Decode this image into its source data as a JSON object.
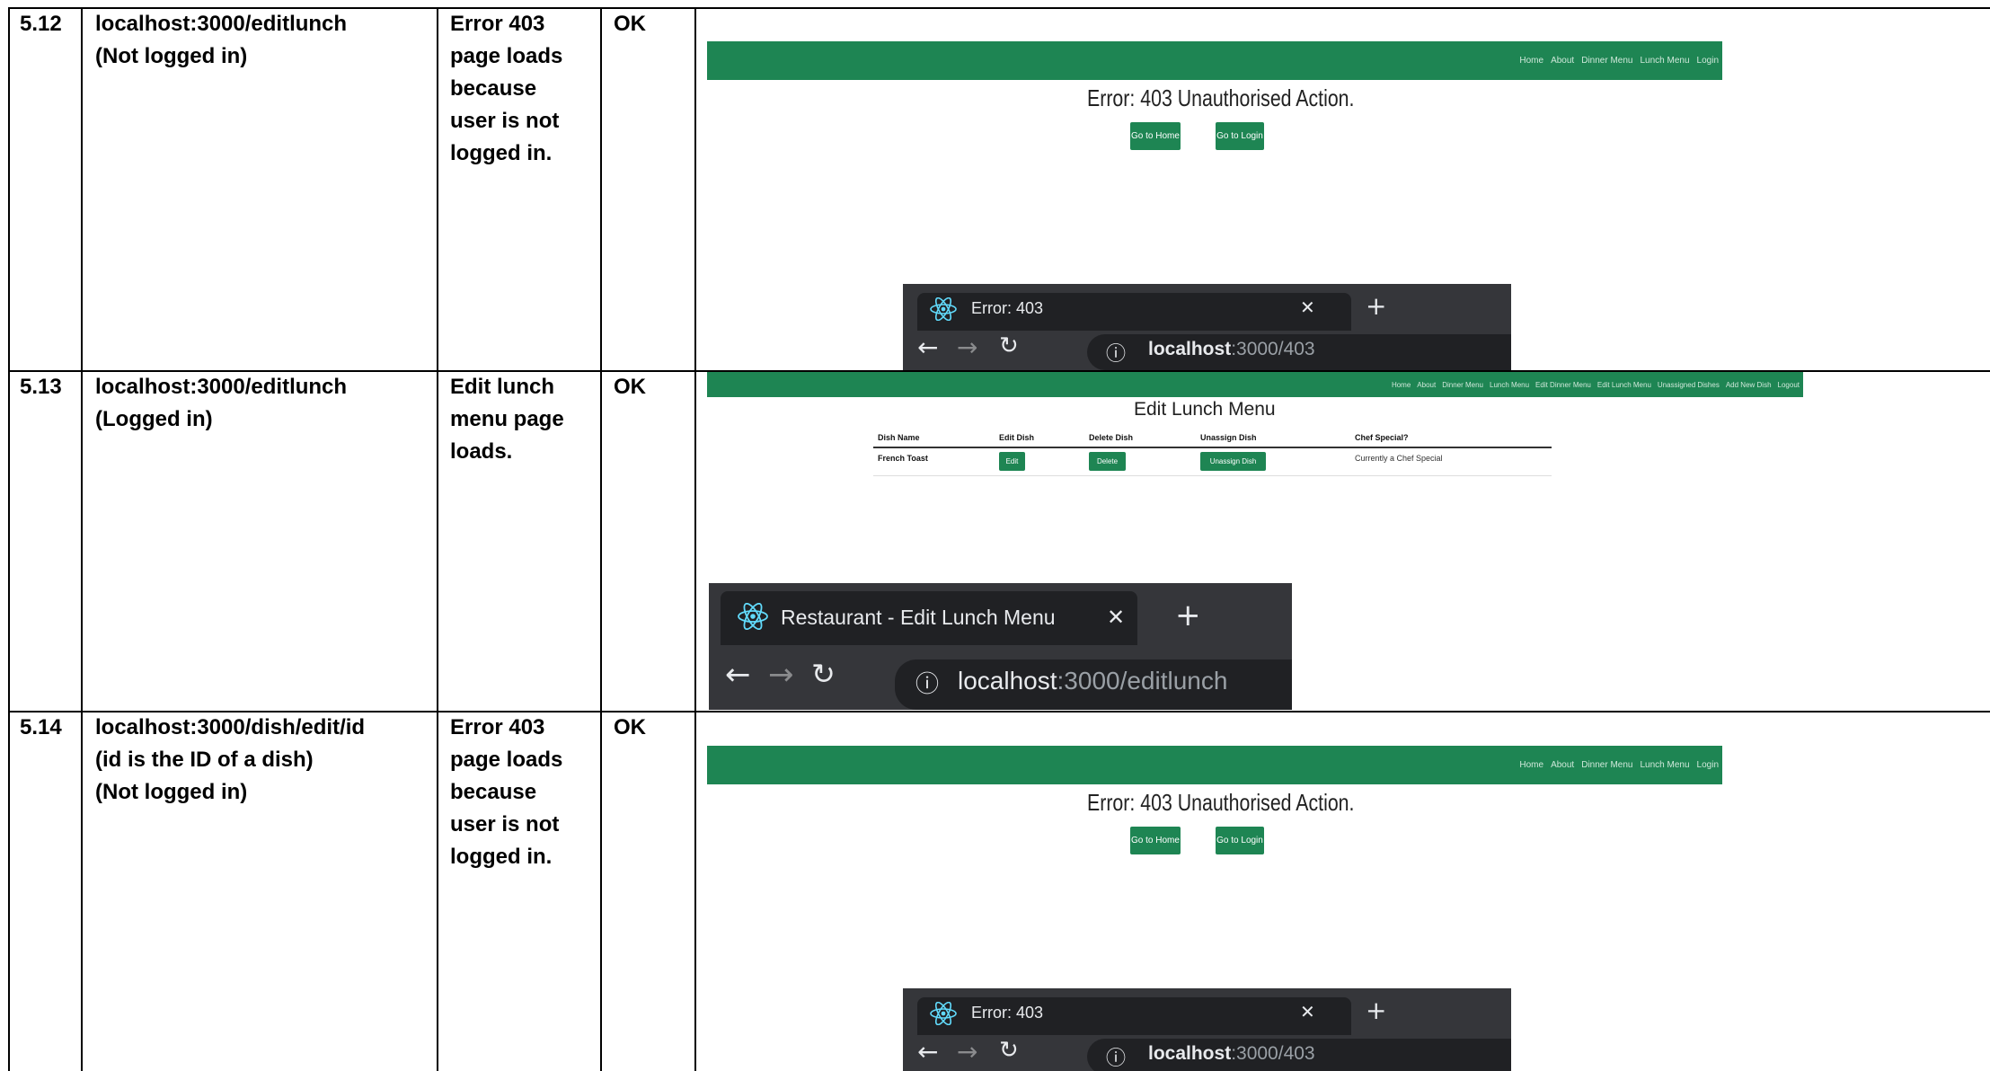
{
  "rows": [
    {
      "id": "5.12",
      "input": "localhost:3000/editlunch\n(Not logged in)",
      "expected": "Error 403\npage loads\nbecause\nuser is not\nlogged in.",
      "result": "OK"
    },
    {
      "id": "5.13",
      "input": "localhost:3000/editlunch\n(Logged in)",
      "expected": "Edit lunch\nmenu page\nloads.",
      "result": "OK"
    },
    {
      "id": "5.14",
      "input": "localhost:3000/dish/edit/id\n(id is the ID of a dish)\n(Not logged in)",
      "expected": "Error 403\npage loads\nbecause\nuser is not\nlogged in.",
      "result": "OK"
    }
  ],
  "shot_403": {
    "nav_links": [
      "Home",
      "About",
      "Dinner Menu",
      "Lunch Menu",
      "Login"
    ],
    "title": "Error: 403 Unauthorised Action.",
    "home_button": "Go to Home",
    "login_button": "Go to Login",
    "tab_title": "Error: 403",
    "url_host": "localhost",
    "url_rest": ":3000/403"
  },
  "shot_edit": {
    "nav_links": [
      "Home",
      "About",
      "Dinner Menu",
      "Lunch Menu",
      "Edit Dinner Menu",
      "Edit Lunch Menu",
      "Unassigned Dishes",
      "Add New Dish",
      "Logout"
    ],
    "title": "Edit Lunch Menu",
    "headers": [
      "Dish Name",
      "Edit Dish",
      "Delete Dish",
      "Unassign Dish",
      "Chef Special?"
    ],
    "row": {
      "dish": "French Toast",
      "edit": "Edit",
      "delete": "Delete",
      "unassign": "Unassign Dish",
      "special": "Currently a Chef Special"
    },
    "tab_title": "Restaurant - Edit Lunch Menu",
    "url_host": "localhost",
    "url_rest": ":3000/editlunch"
  },
  "colors": {
    "brand_green": "#1e8553",
    "browser_dark": "#35363a",
    "tab_dark": "#202124"
  },
  "icons": [
    "react-logo-icon",
    "close-icon",
    "plus-icon",
    "back-arrow-icon",
    "forward-arrow-icon",
    "reload-icon",
    "info-icon"
  ]
}
